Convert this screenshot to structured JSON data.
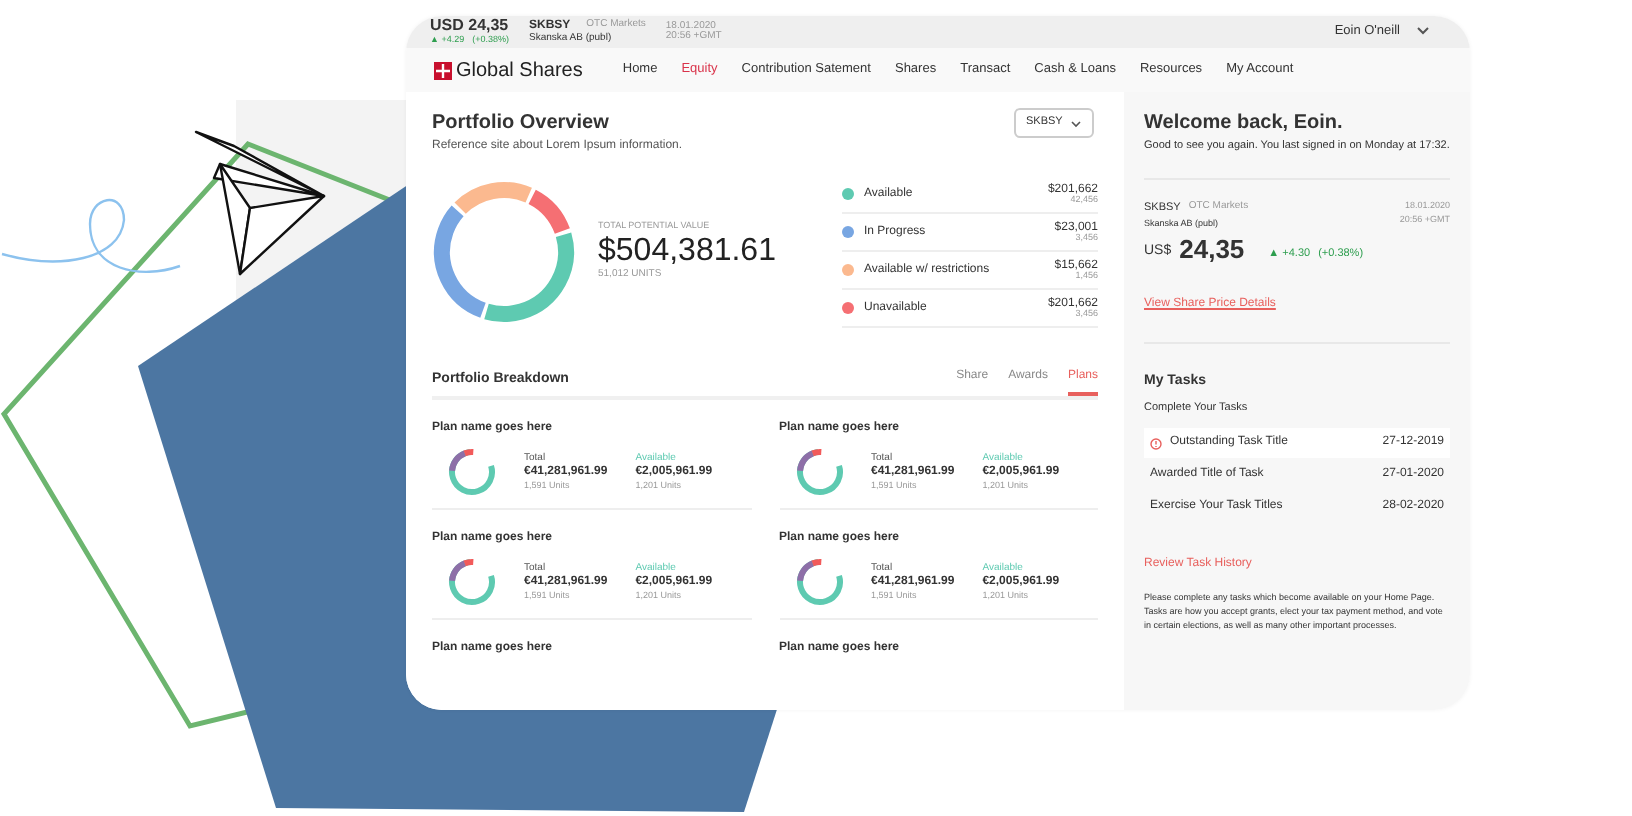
{
  "ticker": {
    "price": "USD 24,35",
    "change": "▲ +4.29",
    "change_pct": "(+0.38%)",
    "symbol": "SKBSY",
    "market": "OTC Markets",
    "company": "Skanska AB (publ)",
    "date": "18.01.2020",
    "time": "20:56 +GMT"
  },
  "user": {
    "name": "Eoin O'neill"
  },
  "brand": "Global Shares",
  "nav": [
    {
      "label": "Home",
      "selected": false
    },
    {
      "label": "Equity",
      "selected": true
    },
    {
      "label": "Contribution Satement",
      "selected": false
    },
    {
      "label": "Shares",
      "selected": false
    },
    {
      "label": "Transact",
      "selected": false
    },
    {
      "label": "Cash & Loans",
      "selected": false
    },
    {
      "label": "Resources",
      "selected": false
    },
    {
      "label": "My Account",
      "selected": false
    }
  ],
  "overview": {
    "title": "Portfolio Overview",
    "subtitle": "Reference site about Lorem Ipsum information.",
    "select": "SKBSY",
    "total_label": "TOTAL POTENTIAL VALUE",
    "total": "$504,381.61",
    "units": "51,012 UNITS",
    "legend": [
      {
        "label": "Available",
        "value": "$201,662",
        "units": "42,456",
        "color": "#5ecab1"
      },
      {
        "label": "In Progress",
        "value": "$23,001",
        "units": "3,456",
        "color": "#78a6e2"
      },
      {
        "label": "Available w/ restrictions",
        "value": "$15,662",
        "units": "1,456",
        "color": "#fbb98f"
      },
      {
        "label": "Unavailable",
        "value": "$201,662",
        "units": "3,456",
        "color": "#f56f73"
      }
    ]
  },
  "breakdown": {
    "title": "Portfolio Breakdown",
    "tabs": [
      {
        "label": "Share",
        "selected": false
      },
      {
        "label": "Awards",
        "selected": false
      },
      {
        "label": "Plans",
        "selected": true
      }
    ],
    "plans": [
      {
        "name": "Plan name goes here",
        "total_label": "Total",
        "total": "€41,281,961.99",
        "total_units": "1,591 Units",
        "available_label": "Available",
        "available": "€2,005,961.99",
        "available_units": "1,201 Units"
      },
      {
        "name": "Plan name goes here",
        "total_label": "Total",
        "total": "€41,281,961.99",
        "total_units": "1,591 Units",
        "available_label": "Available",
        "available": "€2,005,961.99",
        "available_units": "1,201 Units"
      },
      {
        "name": "Plan name goes here",
        "total_label": "Total",
        "total": "€41,281,961.99",
        "total_units": "1,591 Units",
        "available_label": "Available",
        "available": "€2,005,961.99",
        "available_units": "1,201 Units"
      },
      {
        "name": "Plan name goes here",
        "total_label": "Total",
        "total": "€41,281,961.99",
        "total_units": "1,591 Units",
        "available_label": "Available",
        "available": "€2,005,961.99",
        "available_units": "1,201 Units"
      },
      {
        "name": "Plan name goes here"
      },
      {
        "name": "Plan name goes here"
      }
    ]
  },
  "welcome": {
    "title": "Welcome back,  Eoin.",
    "text": "Good to see you again. You last signed in on Monday at 17:32."
  },
  "stock": {
    "symbol": "SKBSY",
    "market": "OTC Markets",
    "company": "Skanska AB (publ)",
    "date": "18.01.2020",
    "time": "20:56 +GMT",
    "currency": "US$",
    "price": "24,35",
    "change": "▲ +4.30",
    "change_pct": "(+0.38%)",
    "link": "View Share Price Details"
  },
  "tasks": {
    "title": "My Tasks",
    "subtitle": "Complete Your Tasks",
    "items": [
      {
        "title": "Outstanding Task Title",
        "date": "27-12-2019",
        "overdue": true
      },
      {
        "title": "Awarded Title of Task",
        "date": "27-01-2020",
        "overdue": false
      },
      {
        "title": "Exercise Your Task Titles",
        "date": "28-02-2020",
        "overdue": false
      }
    ],
    "link": "Review Task History",
    "note": "Please complete any tasks which become available on your Home Page. Tasks are how you accept grants, elect your tax payment method, and vote in certain elections, as well as many other important processes."
  }
}
